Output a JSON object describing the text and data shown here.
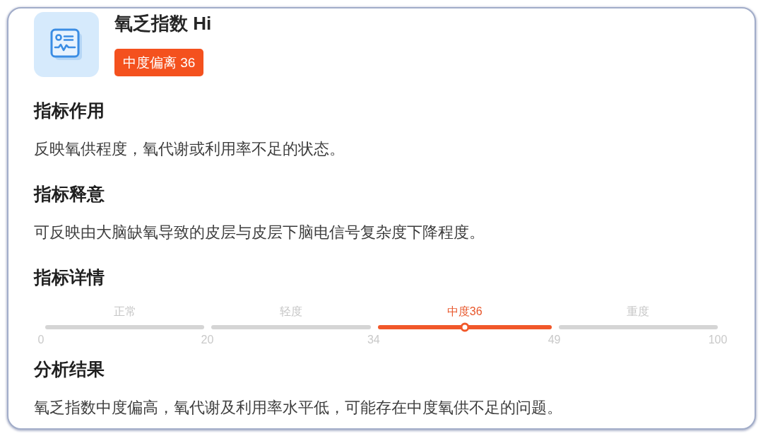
{
  "header": {
    "title": "氧乏指数 Hi",
    "badge": "中度偏离 36"
  },
  "sections": [
    {
      "kind": "text",
      "heading": "指标作用",
      "text": "反映氧供程度，氧代谢或利用率不足的状态。"
    },
    {
      "kind": "text",
      "heading": "指标释意",
      "text": "可反映由大脑缺氧导致的皮层与皮层下脑电信号复杂度下降程度。"
    },
    {
      "kind": "gauge",
      "heading": "指标详情",
      "gauge": {
        "segments": [
          {
            "label": "正常",
            "selected": false
          },
          {
            "label": "轻度",
            "selected": false
          },
          {
            "label": "中度36",
            "selected": true,
            "level": 0.5
          },
          {
            "label": "重度",
            "selected": false
          }
        ],
        "ticks": [
          "0",
          "20",
          "34",
          "49",
          "100"
        ]
      }
    },
    {
      "kind": "text",
      "heading": "分析结果",
      "text": "氧乏指数中度偏高，氧代谢及利用率水平低，可能存在中度氧供不足的问题。"
    }
  ]
}
